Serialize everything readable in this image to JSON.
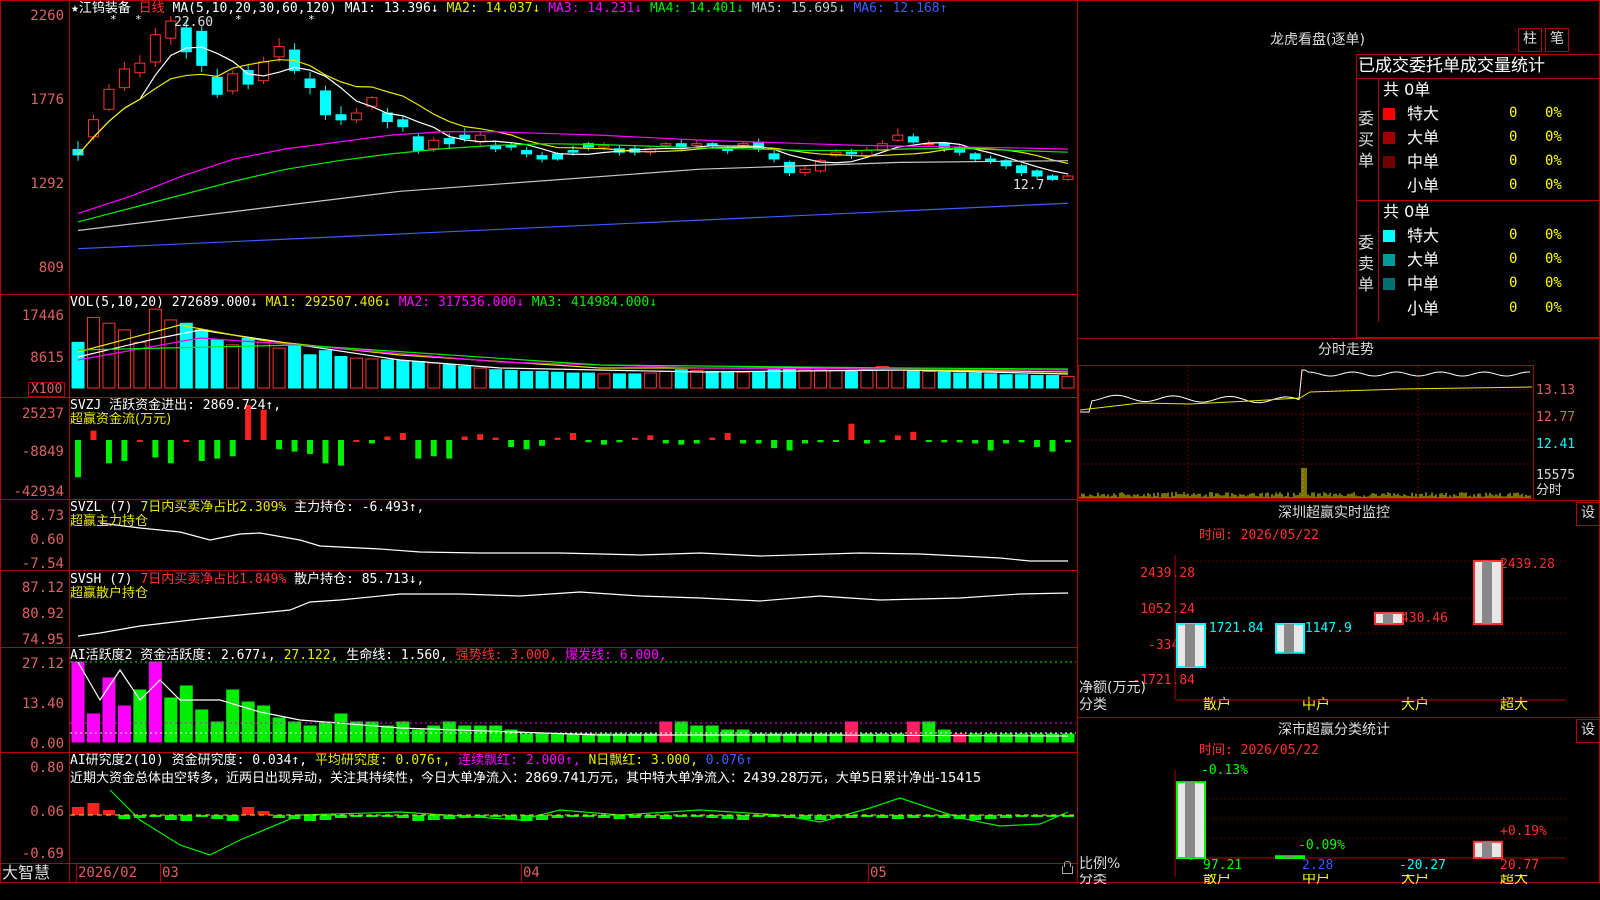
{
  "stock": {
    "star": "★",
    "name": "江钨装备",
    "period": "日线",
    "high_mark": "22.60",
    "last_mark": "12.7"
  },
  "main_panel": {
    "axis": [
      "2260",
      "1776",
      "1292",
      "809"
    ],
    "ma_header": "MA(5,10,20,30,60,120)",
    "ma": [
      {
        "text": "MA1: 13.396↓",
        "color": "#ffffff"
      },
      {
        "text": "MA2: 14.037↓",
        "color": "#e8e800"
      },
      {
        "text": "MA3: 14.231↓",
        "color": "#ff00ff"
      },
      {
        "text": "MA4: 14.401↓",
        "color": "#00ee00"
      },
      {
        "text": "MA5: 15.695↓",
        "color": "#c8c8c8"
      },
      {
        "text": "MA6: 12.168↑",
        "color": "#3b5cff"
      }
    ]
  },
  "vol_panel": {
    "axis": [
      "17446",
      "8615"
    ],
    "unit": "X100",
    "header": "VOL(5,10,20)",
    "values": [
      {
        "text": "272689.000↓",
        "color": "#ffffff"
      },
      {
        "text": "MA1: 292507.406↓",
        "color": "#e8e800"
      },
      {
        "text": "MA2: 317536.000↓",
        "color": "#ff00ff"
      },
      {
        "text": "MA3: 414984.000↓",
        "color": "#00ee00"
      }
    ]
  },
  "svzj_panel": {
    "axis": [
      "25237",
      "-8849",
      "-42934"
    ],
    "line1": "SVZJ  活跃资金进出: 2869.724↑,",
    "line2": "超赢资金流(万元)"
  },
  "svzl_panel": {
    "axis": [
      "8.73",
      "0.60",
      "-7.54"
    ],
    "name": "SVZL (7)",
    "pct": "7日内买卖净占比2.309%",
    "main": "主力持仓: -6.493↑,",
    "sub": "超赢主力持仓"
  },
  "svsh_panel": {
    "axis": [
      "87.12",
      "80.92",
      "74.95"
    ],
    "name": "SVSH (7)",
    "pct": "7日内买卖净占比1.849%",
    "main": "散户持仓: 85.713↓,",
    "sub": "超赢散户持仓"
  },
  "ai1_panel": {
    "axis": [
      "27.12",
      "13.40",
      "0.00"
    ],
    "items": [
      {
        "text": "AI活跃度2 资金活跃度: 2.677↓,",
        "color": "#ffffff"
      },
      {
        "text": "27.122,",
        "color": "#e8e800"
      },
      {
        "text": "生命线: 1.560,",
        "color": "#ffffff"
      },
      {
        "text": "强势线: 3.000,",
        "color": "#ff3030"
      },
      {
        "text": "爆发线: 6.000,",
        "color": "#ff00ff"
      }
    ]
  },
  "ai2_panel": {
    "axis": [
      "0.80",
      "0.06",
      "-0.69"
    ],
    "items": [
      {
        "text": "AI研究度2(10) 资金研究度: 0.034↑,",
        "color": "#ffffff"
      },
      {
        "text": "平均研究度: 0.076↑,",
        "color": "#e8e800"
      },
      {
        "text": "连续飘红: 2.000↑,",
        "color": "#ff00ff"
      },
      {
        "text": "N日飘红: 3.000,",
        "color": "#e8e800"
      },
      {
        "text": "0.076↑",
        "color": "#3b5cff"
      }
    ],
    "commentary": "近期大资金总体由空转多，近两日出现异动，关注其持续性，今日大单净流入：2869.741万元，其中特大单净流入：2439.28万元，大单5日累计净出-15415"
  },
  "time_axis": {
    "brand": "大智慧",
    "labels": [
      "2026/02",
      "03",
      "04",
      "05"
    ]
  },
  "longhu": {
    "title": "龙虎看盘(逐单)",
    "tabs": [
      "柱",
      "笔"
    ],
    "subtitle": "已成交委托单成交量统计",
    "buy": {
      "side": "委买单",
      "count": "共 0单",
      "rows": [
        {
          "label": "特大",
          "qty": "0",
          "pct": "0%",
          "color": "#ff0000"
        },
        {
          "label": "大单",
          "qty": "0",
          "pct": "0%",
          "color": "#a00000"
        },
        {
          "label": "中单",
          "qty": "0",
          "pct": "0%",
          "color": "#700000"
        },
        {
          "label": "小单",
          "qty": "0",
          "pct": "0%",
          "color": ""
        }
      ]
    },
    "sell": {
      "side": "委卖单",
      "count": "共 0单",
      "rows": [
        {
          "label": "特大",
          "qty": "0",
          "pct": "0%",
          "color": "#00ffff"
        },
        {
          "label": "大单",
          "qty": "0",
          "pct": "0%",
          "color": "#009a9a"
        },
        {
          "label": "中单",
          "qty": "0",
          "pct": "0%",
          "color": "#007070"
        },
        {
          "label": "小单",
          "qty": "0",
          "pct": "0%",
          "color": ""
        }
      ]
    }
  },
  "intraday": {
    "title": "分时走势",
    "axis": [
      "13.13",
      "12.77",
      "12.41"
    ],
    "vol": "15575",
    "period": "分时"
  },
  "sz_monitor": {
    "title": "深圳超赢实时监控",
    "settings": "设",
    "time": "时间: 2026/05/22",
    "axis": [
      "2439.28",
      "1052.24",
      "-334.8",
      "-1721.84"
    ],
    "ylabel1": "净额(万元)",
    "ylabel2": "分类",
    "bars": [
      {
        "cat": "散户",
        "value": -1721.84,
        "label": "-1721.84",
        "color": "#00ffff"
      },
      {
        "cat": "中户",
        "value": -1147.9,
        "label": "-1147.9",
        "color": "#00ffff"
      },
      {
        "cat": "大户",
        "value": 430.46,
        "label": "430.46",
        "color": "#ff3030"
      },
      {
        "cat": "超大",
        "value": 2439.28,
        "label": "2439.28",
        "color": "#ff3030"
      }
    ]
  },
  "sz_stats": {
    "title": "深市超赢分类统计",
    "settings": "设",
    "time": "时间: 2026/05/22",
    "axis": [
      "75",
      "50",
      "25",
      "0"
    ],
    "ylabel1": "比例%",
    "ylabel2": "分类",
    "bars": [
      {
        "cat": "散户",
        "top": "-0.13%",
        "bottom": "97.21",
        "value": 97.21,
        "top_color": "#00ff00",
        "bottom_color": "#00ff00"
      },
      {
        "cat": "中户",
        "top": "-0.09%",
        "bottom": "2.28",
        "value": 2.28,
        "top_color": "#00ff00",
        "bottom_color": "#3b5cff"
      },
      {
        "cat": "大户",
        "top": "",
        "bottom": "-20.27",
        "value": 0,
        "top_color": "#00ff00",
        "bottom_color": "#00ffff"
      },
      {
        "cat": "超大",
        "top": "+0.19%",
        "bottom": "20.77",
        "value": 20.77,
        "top_color": "#ff3030",
        "bottom_color": "#ff3030"
      }
    ]
  },
  "chart_data": {
    "type": "candlestick",
    "title": "江钨装备 日线",
    "y_axis_ticks": [
      2260,
      1776,
      1292,
      809
    ],
    "x_axis_labels": [
      "2026/02",
      "03",
      "04",
      "05"
    ],
    "candles_estimated": [
      [
        1476,
        1444,
        1525,
        1410
      ],
      [
        1550,
        1651,
        1680,
        1530
      ],
      [
        1712,
        1829,
        1860,
        1700
      ],
      [
        1839,
        1949,
        1990,
        1820
      ],
      [
        1927,
        1983,
        2030,
        1900
      ],
      [
        1990,
        2150,
        2190,
        1960
      ],
      [
        2130,
        2230,
        2260,
        2090
      ],
      [
        2190,
        2050,
        2240,
        2010
      ],
      [
        2170,
        1970,
        2200,
        1930
      ],
      [
        1900,
        1800,
        1950,
        1780
      ],
      [
        1820,
        1920,
        1940,
        1800
      ],
      [
        1940,
        1860,
        1980,
        1830
      ],
      [
        1880,
        1990,
        2020,
        1860
      ],
      [
        2020,
        2080,
        2130,
        1990
      ],
      [
        2060,
        1940,
        2100,
        1920
      ],
      [
        1890,
        1840,
        1930,
        1800
      ],
      [
        1820,
        1680,
        1850,
        1650
      ],
      [
        1680,
        1650,
        1730,
        1620
      ],
      [
        1650,
        1690,
        1720,
        1630
      ],
      [
        1730,
        1780,
        1790,
        1710
      ],
      [
        1690,
        1640,
        1720,
        1600
      ],
      [
        1650,
        1610,
        1670,
        1580
      ],
      [
        1550,
        1470,
        1570,
        1450
      ],
      [
        1480,
        1530,
        1550,
        1460
      ],
      [
        1540,
        1510,
        1570,
        1480
      ],
      [
        1560,
        1540,
        1600,
        1520
      ],
      [
        1520,
        1560,
        1580,
        1500
      ],
      [
        1500,
        1480,
        1530,
        1460
      ],
      [
        1500,
        1490,
        1520,
        1470
      ],
      [
        1470,
        1450,
        1490,
        1430
      ],
      [
        1440,
        1420,
        1460,
        1400
      ],
      [
        1450,
        1420,
        1460,
        1410
      ],
      [
        1470,
        1460,
        1500,
        1440
      ],
      [
        1510,
        1490,
        1520,
        1470
      ],
      [
        1490,
        1500,
        1520,
        1470
      ],
      [
        1480,
        1460,
        1500,
        1440
      ],
      [
        1480,
        1460,
        1500,
        1440
      ],
      [
        1460,
        1480,
        1490,
        1440
      ],
      [
        1500,
        1510,
        1520,
        1480
      ],
      [
        1510,
        1490,
        1540,
        1480
      ],
      [
        1500,
        1510,
        1530,
        1490
      ],
      [
        1510,
        1500,
        1520,
        1480
      ],
      [
        1480,
        1470,
        1500,
        1450
      ],
      [
        1500,
        1510,
        1520,
        1480
      ],
      [
        1520,
        1480,
        1540,
        1460
      ],
      [
        1450,
        1420,
        1470,
        1400
      ],
      [
        1400,
        1340,
        1410,
        1320
      ],
      [
        1340,
        1360,
        1380,
        1320
      ],
      [
        1350,
        1410,
        1420,
        1340
      ],
      [
        1440,
        1460,
        1480,
        1430
      ],
      [
        1460,
        1450,
        1480,
        1420
      ],
      [
        1440,
        1470,
        1490,
        1430
      ],
      [
        1470,
        1510,
        1530,
        1460
      ],
      [
        1530,
        1560,
        1600,
        1520
      ],
      [
        1550,
        1520,
        1570,
        1510
      ],
      [
        1510,
        1510,
        1530,
        1490
      ],
      [
        1510,
        1480,
        1520,
        1460
      ],
      [
        1490,
        1460,
        1500,
        1440
      ],
      [
        1450,
        1420,
        1460,
        1400
      ],
      [
        1420,
        1410,
        1440,
        1390
      ],
      [
        1410,
        1380,
        1420,
        1360
      ],
      [
        1380,
        1340,
        1390,
        1320
      ],
      [
        1350,
        1320,
        1360,
        1300
      ],
      [
        1320,
        1300,
        1330,
        1290
      ],
      [
        1300,
        1320,
        1330,
        1290
      ]
    ]
  }
}
